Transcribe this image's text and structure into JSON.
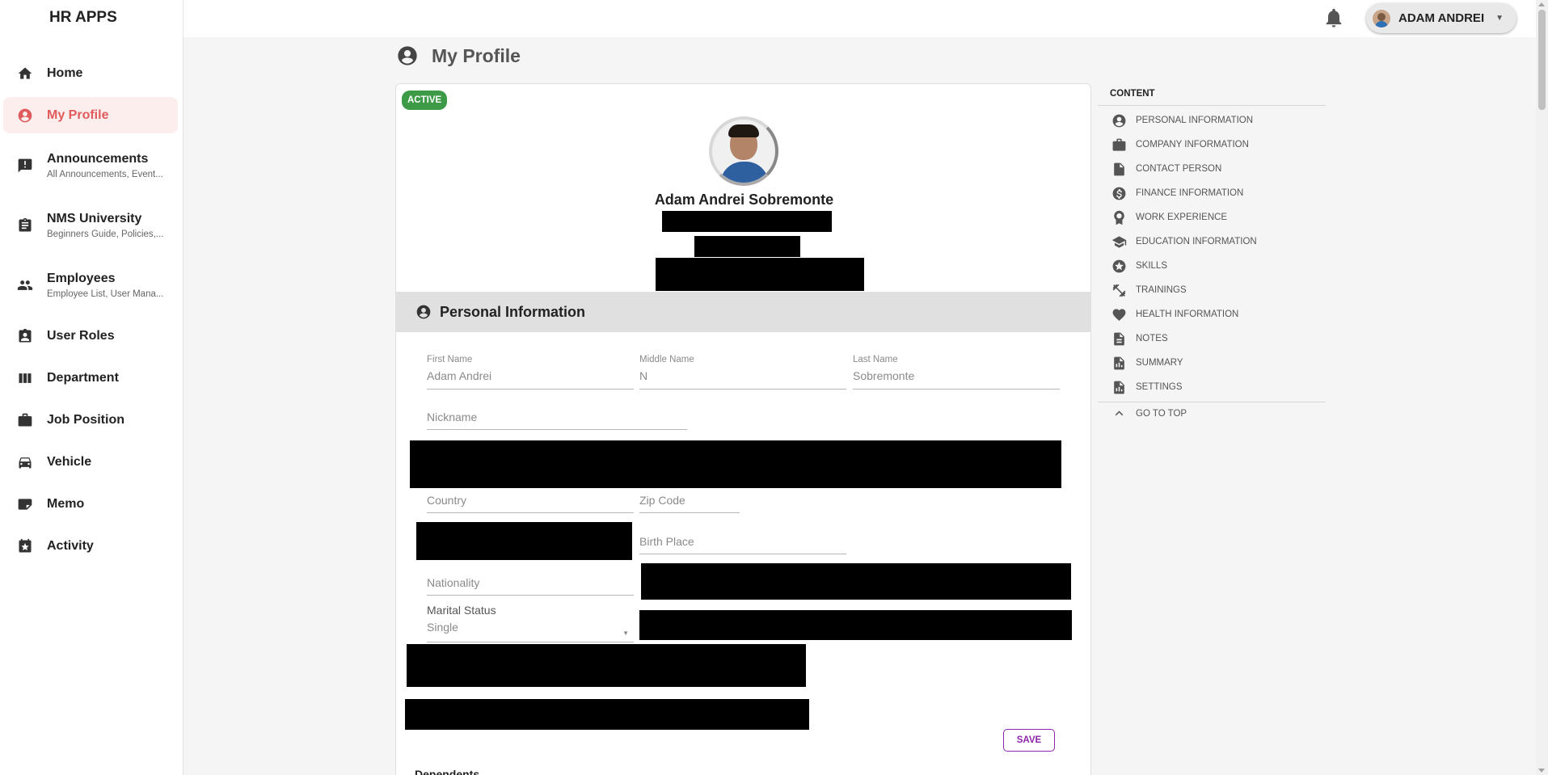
{
  "app": {
    "brand": "HR APPS"
  },
  "sidebar": {
    "items": [
      {
        "label": "Home",
        "icon": "home-icon"
      },
      {
        "label": "My Profile",
        "icon": "account-circle-icon",
        "active": true
      },
      {
        "label": "Announcements",
        "sub": "All Announcements, Event...",
        "icon": "announcement-icon"
      },
      {
        "label": "NMS University",
        "sub": "Beginners Guide, Policies,...",
        "icon": "clipboard-icon"
      },
      {
        "label": "Employees",
        "sub": "Employee List, User Mana...",
        "icon": "people-icon"
      },
      {
        "label": "User Roles",
        "icon": "badge-icon"
      },
      {
        "label": "Department",
        "icon": "columns-icon"
      },
      {
        "label": "Job Position",
        "icon": "briefcase-icon"
      },
      {
        "label": "Vehicle",
        "icon": "car-icon"
      },
      {
        "label": "Memo",
        "icon": "memo-icon"
      },
      {
        "label": "Activity",
        "icon": "event-star-icon"
      }
    ],
    "active_color": "#e05b5b",
    "active_bg": "#fdeeee"
  },
  "topbar": {
    "user_name": "ADAM ANDREI",
    "bell_icon": "bell-icon"
  },
  "page": {
    "title": "My Profile"
  },
  "profile": {
    "status": "ACTIVE",
    "status_color": "#3d9b47",
    "name": "Adam Andrei Sobremonte"
  },
  "personal": {
    "section_title": "Personal Information",
    "first_name": {
      "label": "First Name",
      "value": "Adam Andrei"
    },
    "middle_name": {
      "label": "Middle Name",
      "value": "N"
    },
    "last_name": {
      "label": "Last Name",
      "value": "Sobremonte"
    },
    "nickname": {
      "placeholder": "Nickname"
    },
    "country": {
      "placeholder": "Country"
    },
    "zip_code": {
      "placeholder": "Zip Code"
    },
    "birth_place": {
      "placeholder": "Birth Place"
    },
    "nationality": {
      "placeholder": "Nationality"
    },
    "marital_status": {
      "label": "Marital Status",
      "value": "Single"
    },
    "save_label": "SAVE",
    "save_color": "#8e24aa",
    "dependents_title": "Dependents"
  },
  "toc": {
    "title": "CONTENT",
    "items": [
      {
        "label": "PERSONAL INFORMATION",
        "icon": "account-circle-icon"
      },
      {
        "label": "COMPANY INFORMATION",
        "icon": "briefcase-icon"
      },
      {
        "label": "CONTACT PERSON",
        "icon": "file-icon"
      },
      {
        "label": "FINANCE INFORMATION",
        "icon": "dollar-circle-icon"
      },
      {
        "label": "WORK EXPERIENCE",
        "icon": "award-icon"
      },
      {
        "label": "EDUCATION INFORMATION",
        "icon": "school-icon"
      },
      {
        "label": "SKILLS",
        "icon": "star-circle-icon"
      },
      {
        "label": "TRAININGS",
        "icon": "fitness-icon"
      },
      {
        "label": "HEALTH INFORMATION",
        "icon": "heart-icon"
      },
      {
        "label": "NOTES",
        "icon": "note-icon"
      },
      {
        "label": "SUMMARY",
        "icon": "summary-icon"
      },
      {
        "label": "SETTINGS",
        "icon": "settings-doc-icon"
      }
    ],
    "go_to_top": "GO TO TOP"
  }
}
